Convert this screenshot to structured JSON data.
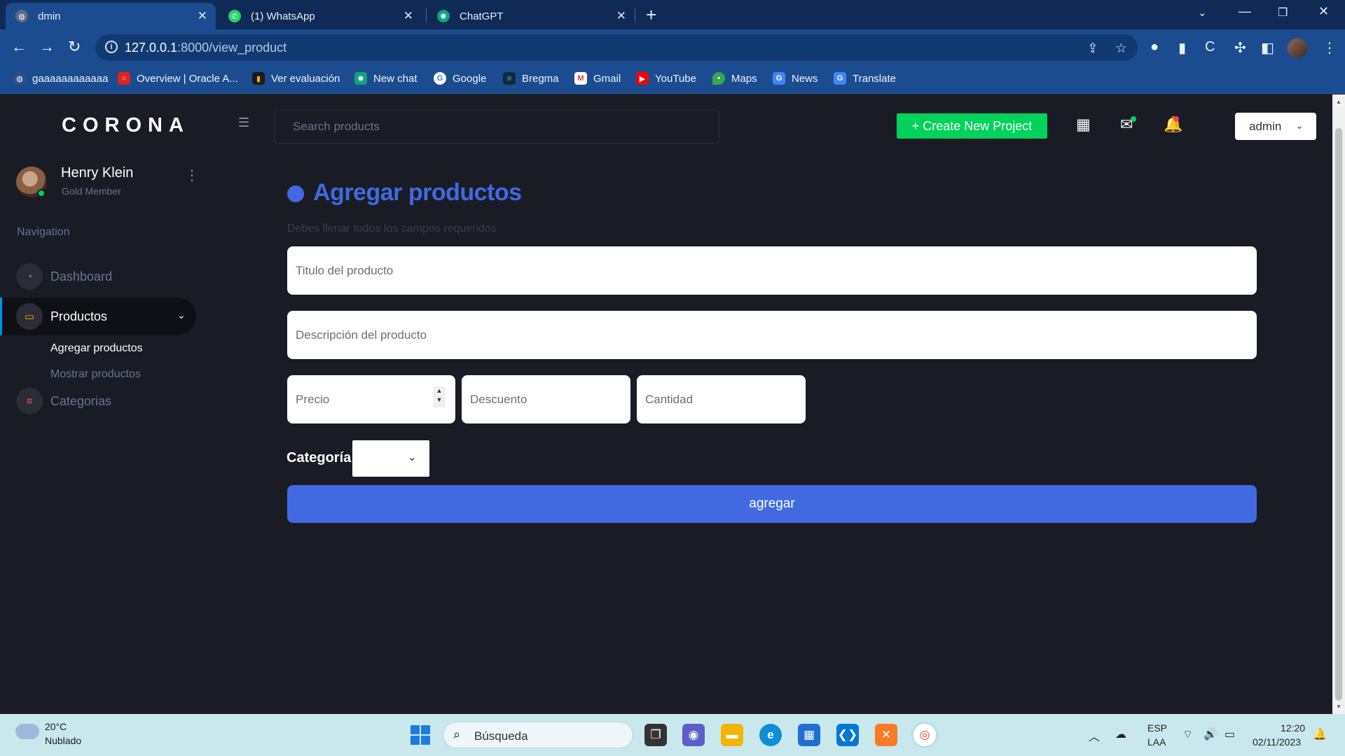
{
  "browser": {
    "tabs": [
      {
        "title": "dmin",
        "active": true
      },
      {
        "title": "(1) WhatsApp",
        "active": false
      },
      {
        "title": "ChatGPT",
        "active": false
      }
    ],
    "url_host": "127.0.0.1",
    "url_rest": ":8000/view_product",
    "bookmarks": [
      "gaaaaaaaaaaaa",
      "Overview | Oracle A...",
      "Ver evaluación",
      "New chat",
      "Google",
      "Bregma",
      "Gmail",
      "YouTube",
      "Maps",
      "News",
      "Translate"
    ]
  },
  "app": {
    "brand": "CORONA",
    "search_placeholder": "Search products",
    "create_button": "+ Create New Project",
    "admin_label": "admin",
    "user": {
      "name": "Henry Klein",
      "role": "Gold Member"
    },
    "nav_heading": "Navigation",
    "nav": {
      "dashboard": "Dashboard",
      "productos": "Productos",
      "agregar": "Agregar productos",
      "mostrar": "Mostrar productos",
      "categorias": "Categorias"
    },
    "colors": {
      "accent": "#4169e1",
      "success": "#00d25b",
      "sidebar": "#191c24"
    }
  },
  "form": {
    "title": "Agregar productos",
    "hint": "Debes llenar todos los campos requeridos",
    "titulo_placeholder": "Titulo del producto",
    "descripcion_placeholder": "Descripción del producto",
    "precio_placeholder": "Precio",
    "descuento_placeholder": "Descuento",
    "cantidad_placeholder": "Cantidad",
    "categoria_label": "Categoría",
    "submit_label": "agregar"
  },
  "taskbar": {
    "temperature": "20°C",
    "weather": "Nublado",
    "search_label": "Búsqueda",
    "lang_1": "ESP",
    "lang_2": "LAA",
    "time": "12:20",
    "date": "02/11/2023"
  }
}
